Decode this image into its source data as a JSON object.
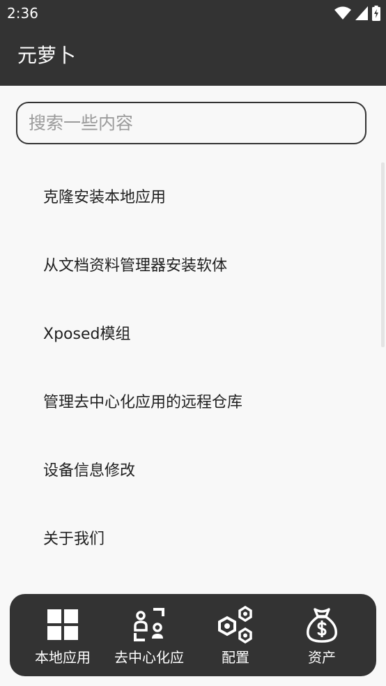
{
  "status_bar": {
    "time": "2:36",
    "icons": [
      "wifi-icon",
      "cell-signal-icon",
      "battery-charging-icon"
    ]
  },
  "app_bar": {
    "title": "元萝卜"
  },
  "search": {
    "placeholder": "搜索一些内容",
    "value": ""
  },
  "menu": {
    "items": [
      {
        "label": "克隆安装本地应用"
      },
      {
        "label": "从文档资料管理器安装软体"
      },
      {
        "label": "Xposed模组"
      },
      {
        "label": "管理去中心化应用的远程仓库"
      },
      {
        "label": "设备信息修改"
      },
      {
        "label": "关于我们"
      }
    ]
  },
  "bottom_nav": {
    "items": [
      {
        "label": "本地应用",
        "icon": "grid-icon"
      },
      {
        "label": "去中心化应",
        "icon": "users-frame-icon"
      },
      {
        "label": "配置",
        "icon": "hexagon-nodes-icon"
      },
      {
        "label": "资产",
        "icon": "money-bag-icon"
      }
    ]
  },
  "colors": {
    "bar_background": "#333333",
    "page_background": "#f8f8f8",
    "text_primary": "#1f1f1f",
    "placeholder": "#9b9b9b",
    "on_dark": "#ffffff"
  }
}
